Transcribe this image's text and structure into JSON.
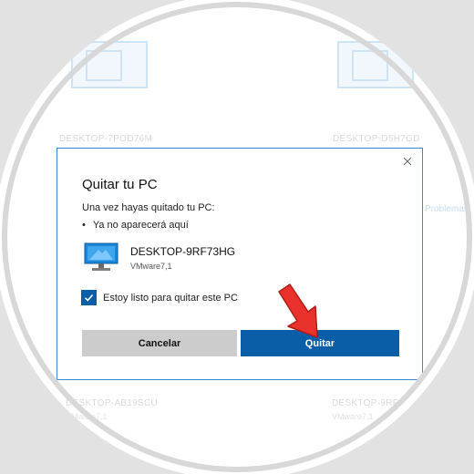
{
  "background": {
    "devices": [
      {
        "name": "DESKTOP-7POD76M",
        "sub": ""
      },
      {
        "name": "DESKTOP-D5H7GD",
        "sub": ""
      },
      {
        "name": "DESKTOP-AB19SCU",
        "sub": "VMware7,1"
      },
      {
        "name": "DESKTOP-9RF",
        "sub": "VMware7,1"
      }
    ],
    "link": "Problemas"
  },
  "dialog": {
    "title": "Quitar tu PC",
    "subtitle": "Una vez hayas quitado tu PC:",
    "bullet": "Ya no aparecerá aquí",
    "device_name": "DESKTOP-9RF73HG",
    "device_model": "VMware7,1",
    "confirm_label": "Estoy listo para quitar este PC",
    "confirm_checked": true,
    "cancel_label": "Cancelar",
    "remove_label": "Quitar"
  },
  "icons": {
    "close": "close-icon",
    "device": "monitor-icon",
    "checkmark": "checkmark-icon",
    "pointer": "red-arrow-icon"
  },
  "colors": {
    "accent": "#0a5ea8",
    "dialog_border": "#3a88d8",
    "cancel_bg": "#cccccc",
    "arrow": "#e8322b"
  }
}
